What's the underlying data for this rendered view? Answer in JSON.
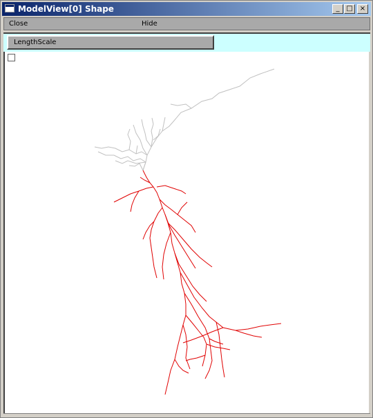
{
  "window": {
    "title": "ModelView[0] Shape"
  },
  "titlebar_buttons": {
    "minimize": "_",
    "maximize": "□",
    "close": "×"
  },
  "menu": {
    "close_label": "Close",
    "hide_label": "Hide"
  },
  "toolbar": {
    "length_scale_label": "LengthScale"
  },
  "colors": {
    "dendrite_gray": "#c8c8c8",
    "dendrite_red": "#e00000",
    "toolbar_bg": "#ccffff"
  },
  "canvas": {
    "checkbox_checked": false
  }
}
